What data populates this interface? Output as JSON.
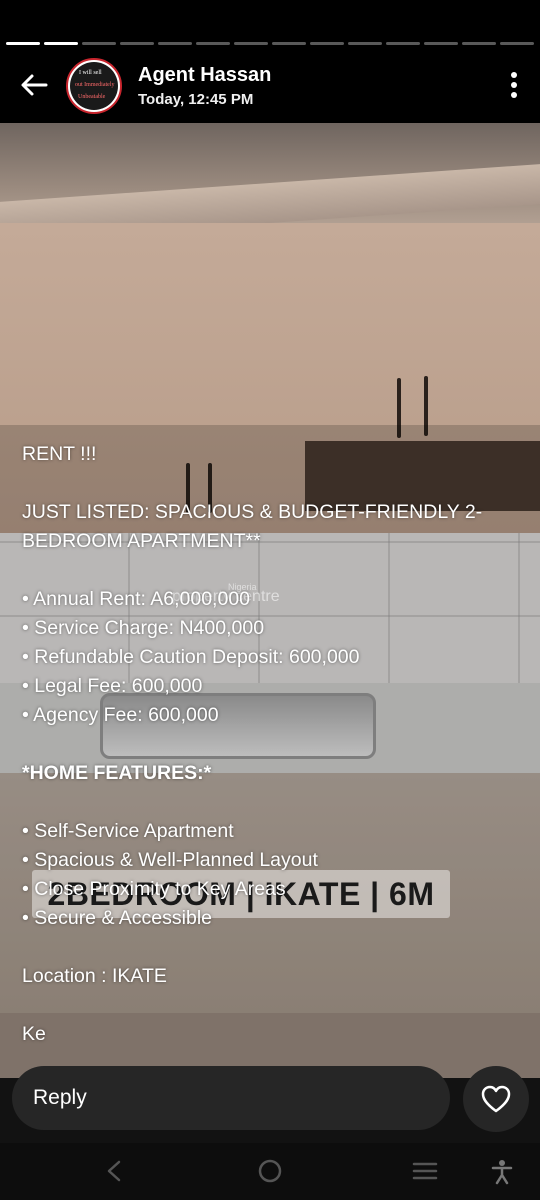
{
  "progress": {
    "total_segments": 14,
    "completed_segments": 2
  },
  "header": {
    "agent_name": "Agent Hassan",
    "timestamp": "Today, 12:45 PM"
  },
  "photo": {
    "watermark_small": "Nigeria",
    "watermark": "property centre",
    "tag": "2BEDROOM | IKATE | 6M"
  },
  "caption": {
    "line1": "RENT  !!!",
    "line2": "JUST LISTED: SPACIOUS & BUDGET-FRIENDLY 2-BEDROOM APARTMENT**",
    "line3": "• Annual Rent: A6,000,000",
    "line4": "• Service Charge: N400,000",
    "line5": "• Refundable Caution Deposit: 600,000",
    "line6": "• Legal Fee:  600,000",
    "line7": "• Agency Fee:  600,000",
    "line8": "*HOME FEATURES:*",
    "line9": "• Self-Service Apartment",
    "line10": "• Spacious & Well-Planned Layout",
    "line11": "• Close Proximity to Key Areas",
    "line12": "• Secure & Accessible",
    "line13": "Location : IKATE",
    "line14": "Ke"
  },
  "reply": {
    "placeholder": "Reply"
  },
  "icons": {
    "back": "arrow-left-icon",
    "more": "more-vertical-icon",
    "like": "heart-icon",
    "nav_back": "chevron-left-icon",
    "nav_home": "circle-icon",
    "nav_recents": "menu-lines-icon",
    "accessibility": "accessibility-icon"
  }
}
